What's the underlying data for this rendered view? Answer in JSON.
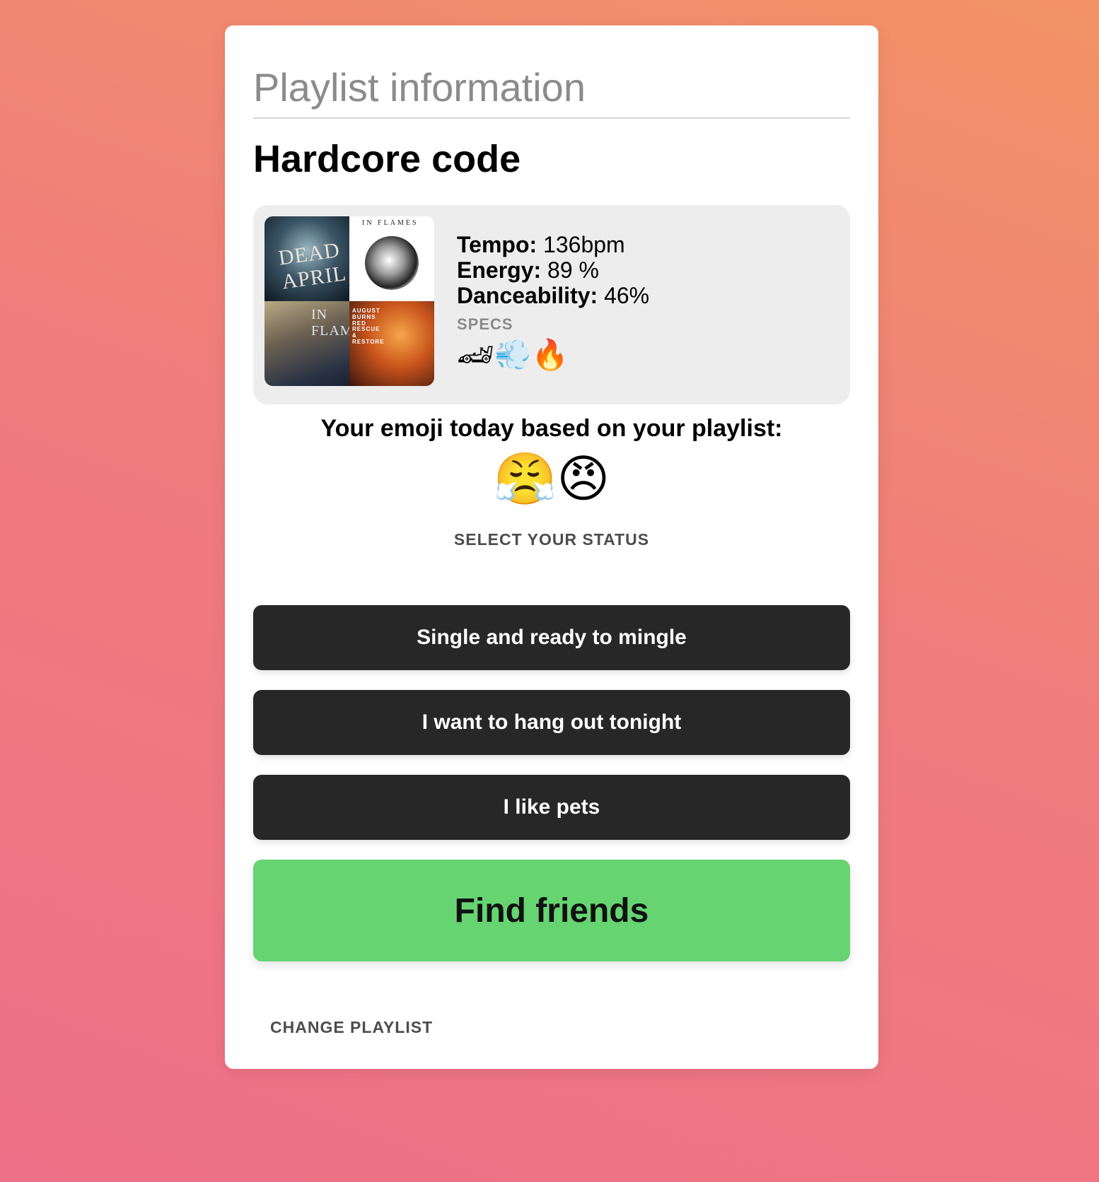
{
  "card": {
    "section_title": "Playlist information",
    "playlist_name": "Hardcore code"
  },
  "covers": {
    "cover_1_text": "DEAD APRIL",
    "cover_2_text": "IN FLAMES",
    "cover_3_text": "IN FLAMES",
    "cover_4_text": "AUGUST BURNS RED RESCUE & RESTORE"
  },
  "stats": {
    "tempo_label": "Tempo:",
    "tempo_value": "136bpm",
    "energy_label": "Energy:",
    "energy_value": "89 %",
    "danceability_label": "Danceability:",
    "danceability_value": "46%",
    "specs_label": "SPECS",
    "specs_emojis": "🏎💨🔥"
  },
  "mood": {
    "heading": "Your emoji today based on your playlist:",
    "emojis": "😤😠"
  },
  "status": {
    "heading": "SELECT YOUR STATUS",
    "options": [
      "Single and ready to mingle",
      "I want to hang out tonight",
      "I like pets"
    ]
  },
  "actions": {
    "find_friends": "Find friends",
    "change_playlist": "CHANGE PLAYLIST"
  },
  "colors": {
    "button_dark": "#272727",
    "button_green": "#65d471",
    "background_top": "#f29366",
    "background_bottom": "#ee7088"
  }
}
